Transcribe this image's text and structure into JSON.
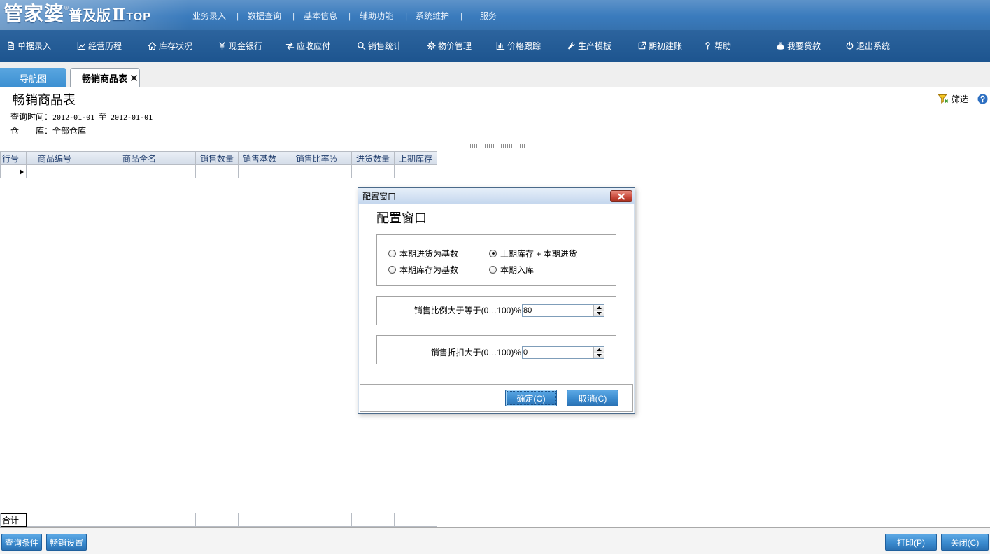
{
  "theme": {
    "header-bg": "#3a7bbd",
    "toolbar-bg": "#1f5a98",
    "tab-nav-bg": "#3b8fd1",
    "button-blue": "#3a8ace",
    "close-red": "#c8473a"
  },
  "logo": {
    "main": "管家婆",
    "reg": "®",
    "edition": "普及版",
    "roman": "Ⅱ",
    "suffix": "TOP"
  },
  "top_menu": {
    "items": [
      "业务录入",
      "数据查询",
      "基本信息",
      "辅助功能",
      "系统维护",
      "服务"
    ],
    "separator": "|"
  },
  "toolbar": {
    "items": [
      {
        "label": "单据录入",
        "icon": "document-icon"
      },
      {
        "label": "经营历程",
        "icon": "line-chart-icon"
      },
      {
        "label": "库存状况",
        "icon": "home-icon"
      },
      {
        "label": "现金银行",
        "icon": "yen-icon"
      },
      {
        "label": "应收应付",
        "icon": "exchange-arrows-icon"
      },
      {
        "label": "销售统计",
        "icon": "search-icon"
      },
      {
        "label": "物价管理",
        "icon": "gear-icon"
      },
      {
        "label": "价格跟踪",
        "icon": "bar-chart-icon"
      },
      {
        "label": "生产模板",
        "icon": "wrench-icon"
      },
      {
        "label": "期初建账",
        "icon": "external-link-icon"
      },
      {
        "label": "帮助",
        "icon": "help-icon"
      },
      {
        "label": "我要贷款",
        "icon": "money-bag-icon"
      },
      {
        "label": "退出系统",
        "icon": "power-icon"
      }
    ]
  },
  "tabs": [
    {
      "label": "导航图"
    },
    {
      "label": "畅销商品表",
      "close_icon": "close-icon"
    }
  ],
  "report": {
    "title": "畅销商品表",
    "query_time": {
      "label": "查询时间：",
      "from": "2012-01-01",
      "sep": "至",
      "to": "2012-01-01"
    },
    "warehouse": {
      "label_chars": [
        "仓",
        "库："
      ],
      "value": "全部仓库"
    },
    "filter_label": "筛选",
    "filter_icon": "filter-icon",
    "help_icon": "help-circle-icon"
  },
  "table": {
    "columns": [
      "行号",
      "商品编号",
      "商品全名",
      "销售数量",
      "销售基数",
      "销售比率%",
      "进货数量",
      "上期库存"
    ],
    "footer_label": "合计"
  },
  "bottom_bar": {
    "query_conditions": "查询条件",
    "bestseller_settings": "畅销设置",
    "print": "打印(P)",
    "close": "关闭(C)"
  },
  "dialog": {
    "title": "配置窗口",
    "heading": "配置窗口",
    "base_options": [
      {
        "label": "本期进货为基数",
        "checked": false
      },
      {
        "label": "上期库存 + 本期进货",
        "checked": true
      },
      {
        "label": "本期库存为基数",
        "checked": false
      },
      {
        "label": "本期入库",
        "checked": false
      }
    ],
    "sales_ratio": {
      "label": "销售比例大于等于(0…100)%",
      "value": "80"
    },
    "sales_discount": {
      "label": "销售折扣大于(0…100)%",
      "value": "0"
    },
    "ok_label": "确定(O)",
    "cancel_label": "取消(C)"
  }
}
